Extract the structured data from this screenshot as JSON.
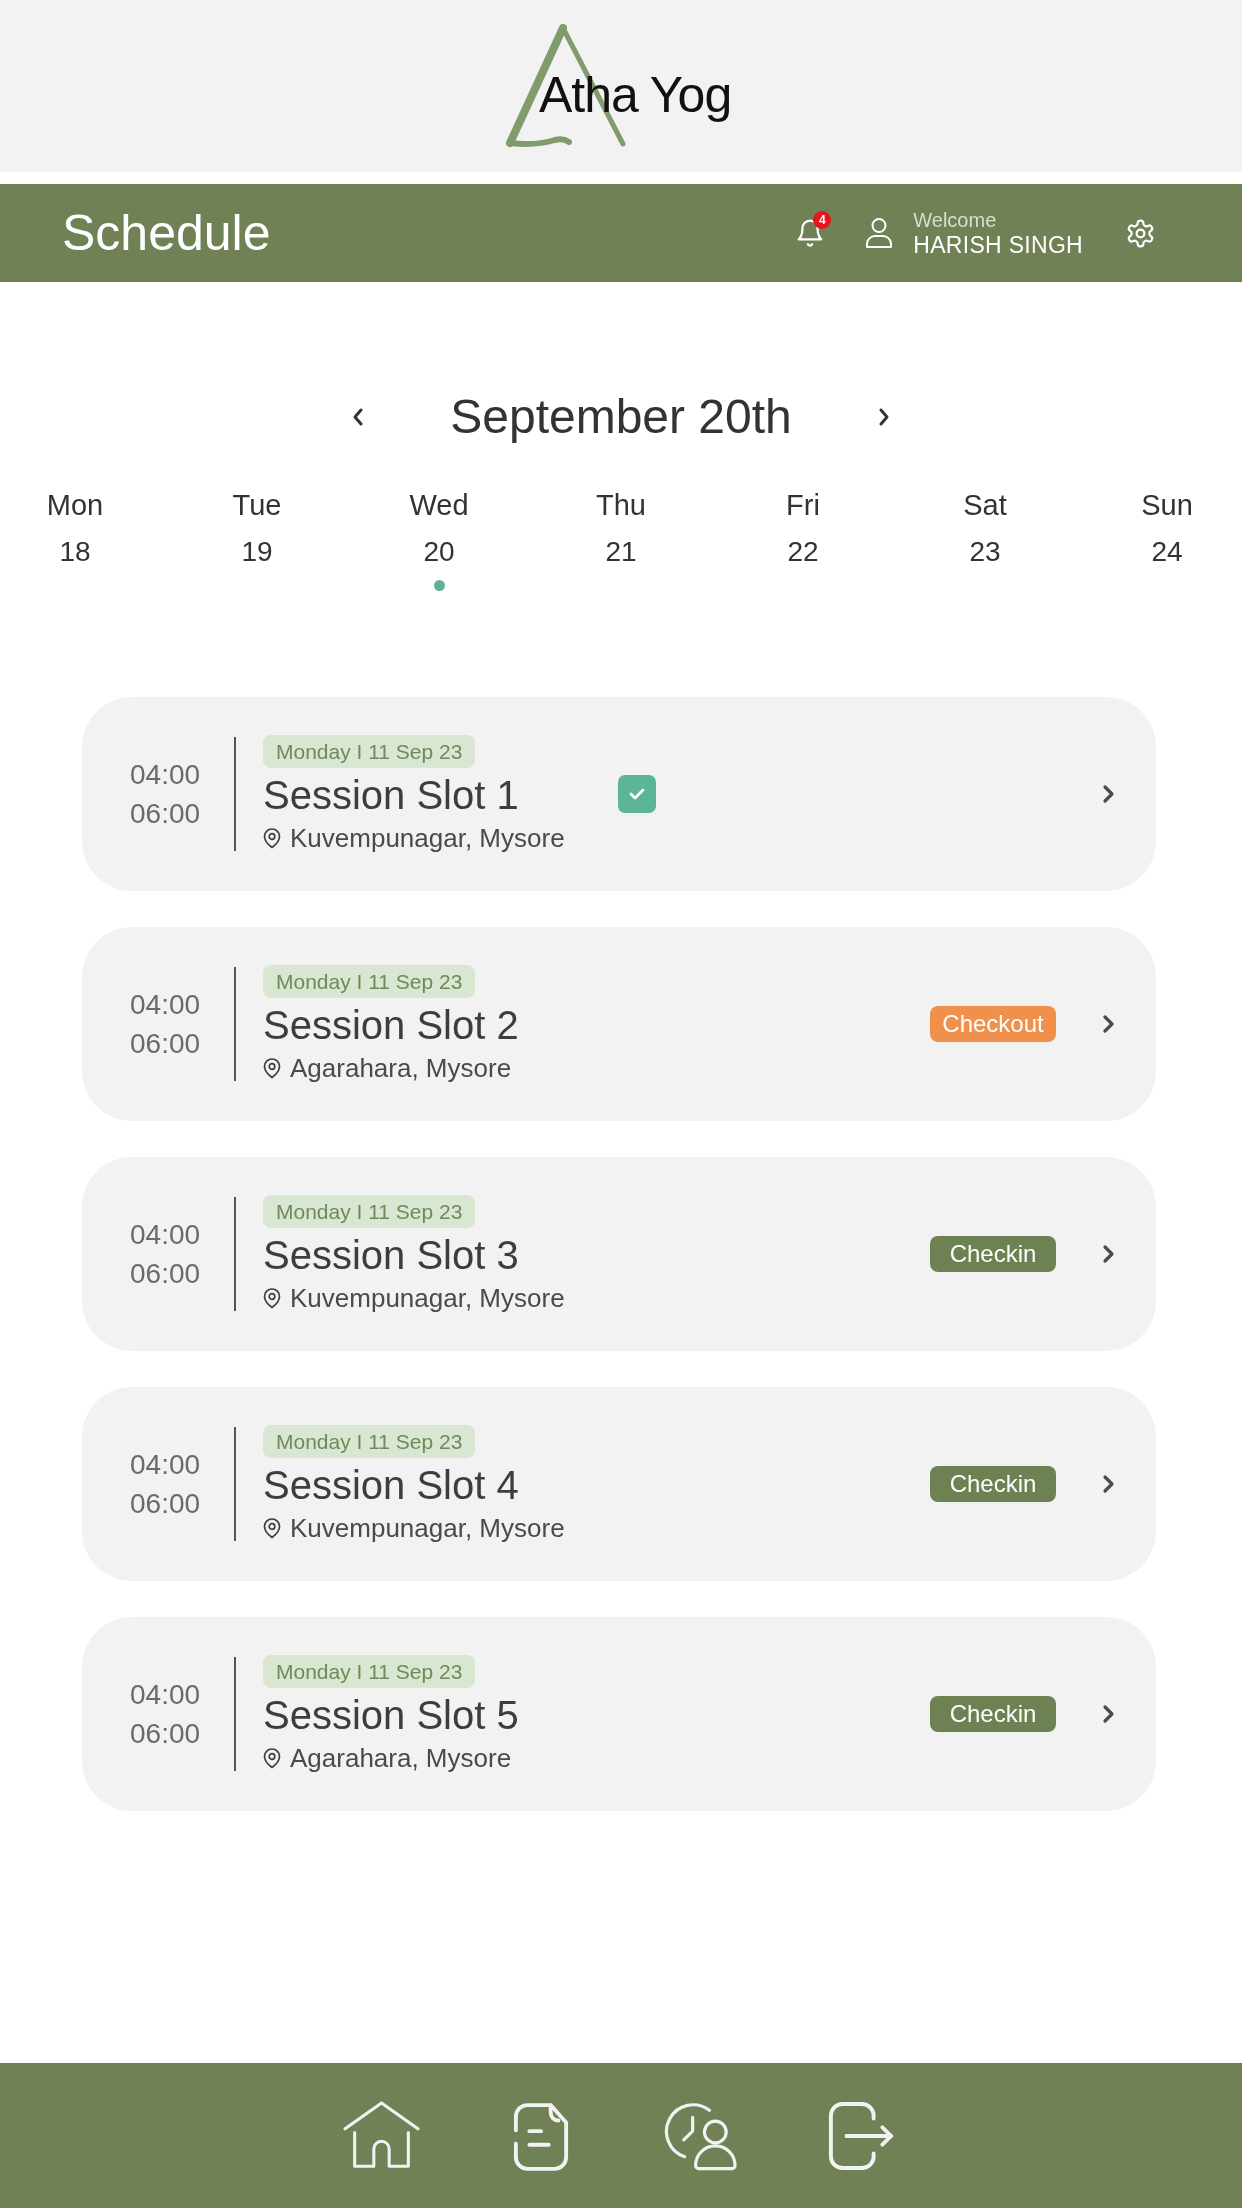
{
  "logo": {
    "text": "Atha Yog"
  },
  "header": {
    "title": "Schedule",
    "notification_count": "4",
    "greeting": "Welcome",
    "user_name": "HARISH SINGH"
  },
  "date_nav": {
    "title": "September 20th"
  },
  "week": [
    {
      "day": "Mon",
      "date": "18",
      "selected": false
    },
    {
      "day": "Tue",
      "date": "19",
      "selected": false
    },
    {
      "day": "Wed",
      "date": "20",
      "selected": true
    },
    {
      "day": "Thu",
      "date": "21",
      "selected": false
    },
    {
      "day": "Fri",
      "date": "22",
      "selected": false
    },
    {
      "day": "Sat",
      "date": "23",
      "selected": false
    },
    {
      "day": "Sun",
      "date": "24",
      "selected": false
    }
  ],
  "sessions": [
    {
      "start": "04:00",
      "end": "06:00",
      "date": "Monday I 11 Sep 23",
      "title": "Session Slot 1",
      "location": "Kuvempunagar, Mysore",
      "kind": "checkbox",
      "checked": true
    },
    {
      "start": "04:00",
      "end": "06:00",
      "date": "Monday I 11 Sep 23",
      "title": "Session Slot 2",
      "location": "Agarahara, Mysore",
      "kind": "button",
      "label": "Checkout",
      "color": "#f0904a"
    },
    {
      "start": "04:00",
      "end": "06:00",
      "date": "Monday I 11 Sep 23",
      "title": "Session Slot 3",
      "location": "Kuvempunagar, Mysore",
      "kind": "button",
      "label": "Checkin",
      "color": "#6e8152"
    },
    {
      "start": "04:00",
      "end": "06:00",
      "date": "Monday I 11 Sep 23",
      "title": "Session Slot 4",
      "location": "Kuvempunagar, Mysore",
      "kind": "button",
      "label": "Checkin",
      "color": "#6e8152"
    },
    {
      "start": "04:00",
      "end": "06:00",
      "date": "Monday I 11 Sep 23",
      "title": "Session Slot 5",
      "location": "Agarahara, Mysore",
      "kind": "button",
      "label": "Checkin",
      "color": "#6e8152"
    }
  ]
}
